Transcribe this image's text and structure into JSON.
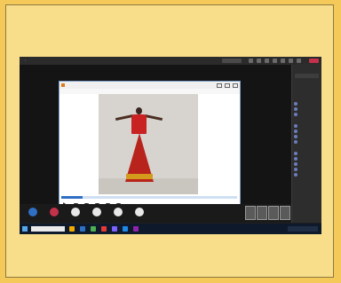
{
  "window": {
    "title": "",
    "share_label": ""
  },
  "player": {
    "title": "",
    "menu": [
      "",
      "",
      "",
      "",
      ""
    ],
    "status": "",
    "time": "",
    "watermark": "",
    "progress": 0.12
  },
  "meeting_controls": [
    {
      "label": "",
      "color": "#2f6fc4"
    },
    {
      "label": "",
      "color": "#c4314b"
    },
    {
      "label": "",
      "color": "#e8e8e8"
    },
    {
      "label": "",
      "color": "#e8e8e8"
    },
    {
      "label": "",
      "color": "#e8e8e8"
    },
    {
      "label": "",
      "color": "#e8e8e8"
    }
  ],
  "participants_panel": {
    "title": "",
    "share_label": "",
    "sections": [
      {
        "label": "",
        "people": [
          "",
          "",
          ""
        ]
      },
      {
        "label": "",
        "people": [
          "",
          "",
          "",
          ""
        ]
      },
      {
        "label": "",
        "people": [
          "",
          "",
          "",
          "",
          ""
        ]
      }
    ]
  },
  "colors": {
    "background": "#f4c95a",
    "screen": "#1f1f1f",
    "accent": "#2f6fc4",
    "leave": "#c4314b",
    "dress": "#c92222"
  },
  "taskbar": {
    "apps": [
      "#f2a900",
      "#2f6fc4",
      "#4caf50",
      "#e53935",
      "#7b61ff",
      "#1e88e5",
      "#8e24aa"
    ]
  }
}
